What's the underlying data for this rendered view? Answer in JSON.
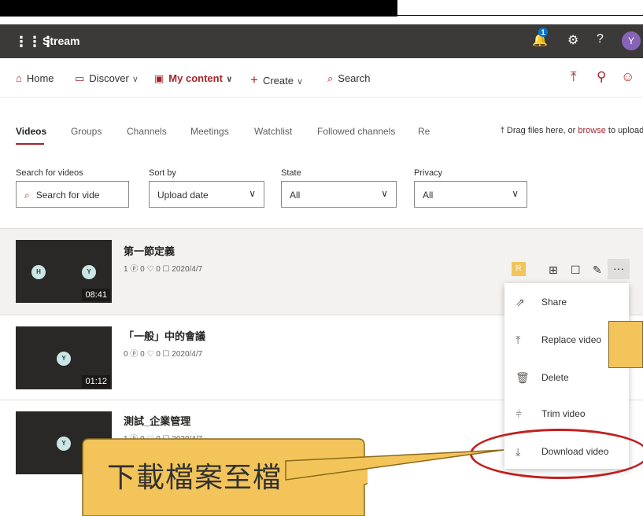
{
  "suite": {
    "app_name": "Stream",
    "notification_count": "1",
    "help_label": "?",
    "avatar_initial": "Y"
  },
  "nav": {
    "home": "Home",
    "discover": "Discover",
    "my_content": "My content",
    "create": "Create",
    "search": "Search"
  },
  "tabs": [
    "Videos",
    "Groups",
    "Channels",
    "Meetings",
    "Watchlist",
    "Followed channels",
    "Re"
  ],
  "upload": {
    "prefix": "Drag files here, or ",
    "browse": "browse",
    "suffix": " to upload"
  },
  "filters": {
    "search_label": "Search for videos",
    "search_placeholder": "Search for vide",
    "sort_label": "Sort by",
    "sort_value": "Upload date",
    "state_label": "State",
    "state_value": "All",
    "privacy_label": "Privacy",
    "privacy_value": "All"
  },
  "videos": [
    {
      "title": "第一節定義",
      "meta": "1 ⓟ  0 ♡  0 ☐  2020/4/7",
      "duration": "08:41",
      "avatars": [
        "H",
        "Y"
      ]
    },
    {
      "title": "「一般」中的會議",
      "meta": "0 ⓟ  0 ♡  0 ☐  2020/4/7",
      "duration": "01:12",
      "avatars": [
        "Y"
      ]
    },
    {
      "title": "測試_企業管理",
      "meta": "1 ⓟ  0 ♡  0 ☐  2020/4/7",
      "duration": "",
      "avatars": [
        "Y"
      ]
    }
  ],
  "menu": {
    "share": "Share",
    "replace": "Replace video",
    "delete": "Delete",
    "trim": "Trim video",
    "download": "Download video"
  },
  "more_label": "···",
  "callout": {
    "text": "下載檔案至檔",
    "color": "#f2c45a"
  },
  "colors": {
    "accent": "#a4262c",
    "suitebar": "#3b3a39",
    "highlight": "#c0201d"
  }
}
